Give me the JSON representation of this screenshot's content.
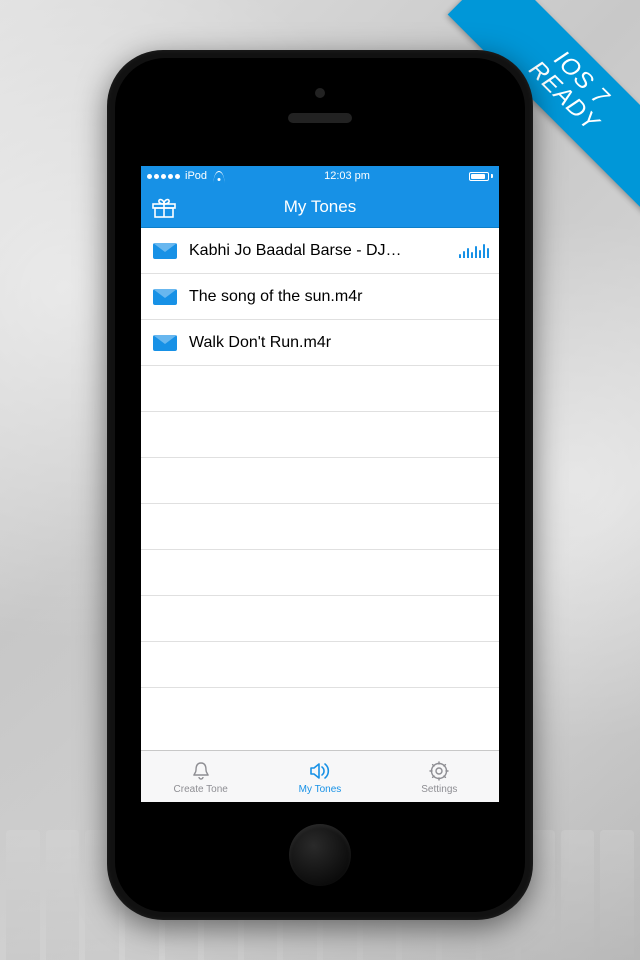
{
  "banner": {
    "line1": "IOS 7",
    "line2": "READY"
  },
  "statusbar": {
    "carrier": "iPod",
    "time": "12:03 pm"
  },
  "navbar": {
    "title": "My Tones"
  },
  "tones": [
    {
      "label": "Kabhi Jo Baadal Barse - DJ…",
      "playing": true
    },
    {
      "label": "The song of the sun.m4r",
      "playing": false
    },
    {
      "label": "Walk Don't Run.m4r",
      "playing": false
    }
  ],
  "tabs": {
    "create": "Create Tone",
    "mytones": "My Tones",
    "settings": "Settings"
  },
  "colors": {
    "accent": "#1791e6"
  }
}
